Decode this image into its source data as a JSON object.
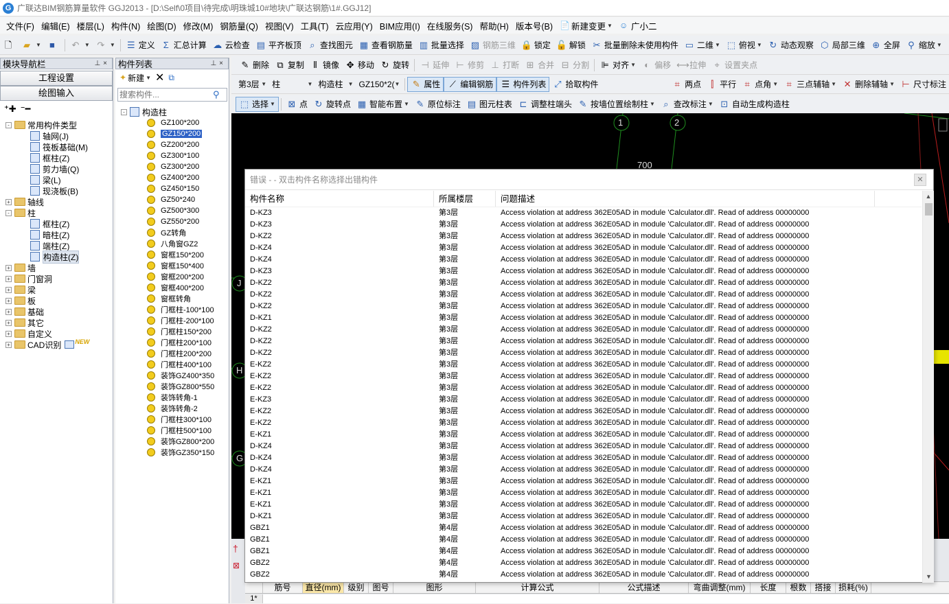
{
  "window": {
    "title": "广联达BIM钢筋算量软件 GGJ2013 - [D:\\Self\\0项目\\待完成\\明珠城10#地块\\广联达钢筋\\1#.GGJ12]"
  },
  "menu": [
    "文件(F)",
    "编辑(E)",
    "楼层(L)",
    "构件(N)",
    "绘图(D)",
    "修改(M)",
    "钢筋量(Q)",
    "视图(V)",
    "工具(T)",
    "云应用(Y)",
    "BIM应用(I)",
    "在线服务(S)",
    "帮助(H)",
    "版本号(B)",
    "新建变更",
    "广小二"
  ],
  "toolbar1": [
    "定义",
    "汇总计算",
    "云检查",
    "平齐板顶",
    "查找图元",
    "查看钢筋量",
    "批量选择",
    "钢筋三维",
    "锁定",
    "解锁",
    "批量删除未使用构件",
    "二维",
    "俯视",
    "动态观察",
    "局部三维",
    "全屏",
    "缩放"
  ],
  "toolbar2": [
    "删除",
    "复制",
    "镜像",
    "移动",
    "旋转",
    "延伸",
    "修剪",
    "打断",
    "合并",
    "分割",
    "对齐",
    "偏移",
    "拉伸",
    "设置夹点"
  ],
  "toolbar3": {
    "floor": "第3层",
    "type": "柱",
    "subtype": "构造柱",
    "component": "GZ150*2(",
    "buttons": [
      "属性",
      "编辑钢筋",
      "构件列表",
      "拾取构件"
    ],
    "right": [
      "两点",
      "平行",
      "点角",
      "三点辅轴",
      "删除辅轴",
      "尺寸标注"
    ]
  },
  "toolbar4": [
    "选择",
    "点",
    "旋转点",
    "智能布置",
    "原位标注",
    "图元柱表",
    "调整柱端头",
    "按墙位置绘制柱",
    "查改标注",
    "自动生成构造柱"
  ],
  "nav": {
    "title": "模块导航栏",
    "btn1": "工程设置",
    "btn2": "绘图输入",
    "tree": [
      {
        "label": "常用构件类型",
        "level": 0,
        "exp": "-",
        "icon": "folder"
      },
      {
        "label": "轴网(J)",
        "level": 1,
        "icon": "comp"
      },
      {
        "label": "筏板基础(M)",
        "level": 1,
        "icon": "comp"
      },
      {
        "label": "框柱(Z)",
        "level": 1,
        "icon": "comp"
      },
      {
        "label": "剪力墙(Q)",
        "level": 1,
        "icon": "comp"
      },
      {
        "label": "梁(L)",
        "level": 1,
        "icon": "comp"
      },
      {
        "label": "现浇板(B)",
        "level": 1,
        "icon": "comp"
      },
      {
        "label": "轴线",
        "level": 0,
        "exp": "+",
        "icon": "folder"
      },
      {
        "label": "柱",
        "level": 0,
        "exp": "-",
        "icon": "folder"
      },
      {
        "label": "框柱(Z)",
        "level": 1,
        "icon": "comp"
      },
      {
        "label": "暗柱(Z)",
        "level": 1,
        "icon": "comp"
      },
      {
        "label": "端柱(Z)",
        "level": 1,
        "icon": "comp"
      },
      {
        "label": "构造柱(Z)",
        "level": 1,
        "icon": "comp",
        "selected": true
      },
      {
        "label": "墙",
        "level": 0,
        "exp": "+",
        "icon": "folder"
      },
      {
        "label": "门窗洞",
        "level": 0,
        "exp": "+",
        "icon": "folder"
      },
      {
        "label": "梁",
        "level": 0,
        "exp": "+",
        "icon": "folder"
      },
      {
        "label": "板",
        "level": 0,
        "exp": "+",
        "icon": "folder"
      },
      {
        "label": "基础",
        "level": 0,
        "exp": "+",
        "icon": "folder"
      },
      {
        "label": "其它",
        "level": 0,
        "exp": "+",
        "icon": "folder"
      },
      {
        "label": "自定义",
        "level": 0,
        "exp": "+",
        "icon": "folder"
      },
      {
        "label": "CAD识别",
        "level": 0,
        "exp": "+",
        "icon": "folder",
        "badge": "NEW"
      }
    ]
  },
  "list": {
    "title": "构件列表",
    "new_label": "新建",
    "search_placeholder": "搜索构件...",
    "root": "构造柱",
    "items": [
      "GZ100*200",
      "GZ150*200",
      "GZ200*200",
      "GZ300*100",
      "GZ300*200",
      "GZ400*200",
      "GZ450*150",
      "GZ50*240",
      "GZ500*300",
      "GZ550*200",
      "GZ转角",
      "八角窗GZ2",
      "窗框150*200",
      "窗框150*400",
      "窗框200*200",
      "窗框400*200",
      "窗框转角",
      "门框柱-100*100",
      "门框柱-200*100",
      "门框柱150*200",
      "门框柱200*100",
      "门框柱200*200",
      "门框柱400*100",
      "装饰GZ400*350",
      "装饰GZ800*550",
      "装饰转角-1",
      "装饰转角-2",
      "门框柱300*100",
      "门框柱500*100",
      "装饰GZ800*200",
      "装饰GZ350*150"
    ],
    "selected_index": 1
  },
  "canvas": {
    "axis_top": [
      "1",
      "2"
    ],
    "axis_left": [
      "J",
      "H",
      "G"
    ],
    "dim_text": "700"
  },
  "dialog": {
    "title": "错误 - - 双击构件名称选择出错构件",
    "headers": [
      "构件名称",
      "所属楼层",
      "问题描述"
    ],
    "rows": [
      [
        "D-KZ3",
        "第3层",
        "Access violation at address 362E05AD in module 'Calculator.dll'. Read of address 00000000"
      ],
      [
        "D-KZ3",
        "第3层",
        "Access violation at address 362E05AD in module 'Calculator.dll'. Read of address 00000000"
      ],
      [
        "D-KZ2",
        "第3层",
        "Access violation at address 362E05AD in module 'Calculator.dll'. Read of address 00000000"
      ],
      [
        "D-KZ4",
        "第3层",
        "Access violation at address 362E05AD in module 'Calculator.dll'. Read of address 00000000"
      ],
      [
        "D-KZ4",
        "第3层",
        "Access violation at address 362E05AD in module 'Calculator.dll'. Read of address 00000000"
      ],
      [
        "D-KZ3",
        "第3层",
        "Access violation at address 362E05AD in module 'Calculator.dll'. Read of address 00000000"
      ],
      [
        "D-KZ2",
        "第3层",
        "Access violation at address 362E05AD in module 'Calculator.dll'. Read of address 00000000"
      ],
      [
        "D-KZ2",
        "第3层",
        "Access violation at address 362E05AD in module 'Calculator.dll'. Read of address 00000000"
      ],
      [
        "D-KZ2",
        "第3层",
        "Access violation at address 362E05AD in module 'Calculator.dll'. Read of address 00000000"
      ],
      [
        "D-KZ1",
        "第3层",
        "Access violation at address 362E05AD in module 'Calculator.dll'. Read of address 00000000"
      ],
      [
        "D-KZ2",
        "第3层",
        "Access violation at address 362E05AD in module 'Calculator.dll'. Read of address 00000000"
      ],
      [
        "D-KZ2",
        "第3层",
        "Access violation at address 362E05AD in module 'Calculator.dll'. Read of address 00000000"
      ],
      [
        "D-KZ2",
        "第3层",
        "Access violation at address 362E05AD in module 'Calculator.dll'. Read of address 00000000"
      ],
      [
        "E-KZ2",
        "第3层",
        "Access violation at address 362E05AD in module 'Calculator.dll'. Read of address 00000000"
      ],
      [
        "E-KZ2",
        "第3层",
        "Access violation at address 362E05AD in module 'Calculator.dll'. Read of address 00000000"
      ],
      [
        "E-KZ2",
        "第3层",
        "Access violation at address 362E05AD in module 'Calculator.dll'. Read of address 00000000"
      ],
      [
        "E-KZ3",
        "第3层",
        "Access violation at address 362E05AD in module 'Calculator.dll'. Read of address 00000000"
      ],
      [
        "E-KZ2",
        "第3层",
        "Access violation at address 362E05AD in module 'Calculator.dll'. Read of address 00000000"
      ],
      [
        "E-KZ2",
        "第3层",
        "Access violation at address 362E05AD in module 'Calculator.dll'. Read of address 00000000"
      ],
      [
        "E-KZ1",
        "第3层",
        "Access violation at address 362E05AD in module 'Calculator.dll'. Read of address 00000000"
      ],
      [
        "D-KZ4",
        "第3层",
        "Access violation at address 362E05AD in module 'Calculator.dll'. Read of address 00000000"
      ],
      [
        "D-KZ4",
        "第3层",
        "Access violation at address 362E05AD in module 'Calculator.dll'. Read of address 00000000"
      ],
      [
        "D-KZ4",
        "第3层",
        "Access violation at address 362E05AD in module 'Calculator.dll'. Read of address 00000000"
      ],
      [
        "E-KZ1",
        "第3层",
        "Access violation at address 362E05AD in module 'Calculator.dll'. Read of address 00000000"
      ],
      [
        "E-KZ1",
        "第3层",
        "Access violation at address 362E05AD in module 'Calculator.dll'. Read of address 00000000"
      ],
      [
        "E-KZ1",
        "第3层",
        "Access violation at address 362E05AD in module 'Calculator.dll'. Read of address 00000000"
      ],
      [
        "D-KZ1",
        "第3层",
        "Access violation at address 362E05AD in module 'Calculator.dll'. Read of address 00000000"
      ],
      [
        "GBZ1",
        "第4层",
        "Access violation at address 362E05AD in module 'Calculator.dll'. Read of address 00000000"
      ],
      [
        "GBZ1",
        "第4层",
        "Access violation at address 362E05AD in module 'Calculator.dll'. Read of address 00000000"
      ],
      [
        "GBZ1",
        "第4层",
        "Access violation at address 362E05AD in module 'Calculator.dll'. Read of address 00000000"
      ],
      [
        "GBZ2",
        "第4层",
        "Access violation at address 362E05AD in module 'Calculator.dll'. Read of address 00000000"
      ],
      [
        "GBZ2",
        "第4层",
        "Access violation at address 362E05AD in module 'Calculator.dll'. Read of address 00000000"
      ]
    ]
  },
  "grid": {
    "headers": [
      "筋号",
      "直径(mm)",
      "级别",
      "图号",
      "图形",
      "计算公式",
      "公式描述",
      "弯曲调整(mm)",
      "长度(mm)",
      "根数",
      "搭接",
      "损耗(%)"
    ],
    "first_row": "1*"
  }
}
